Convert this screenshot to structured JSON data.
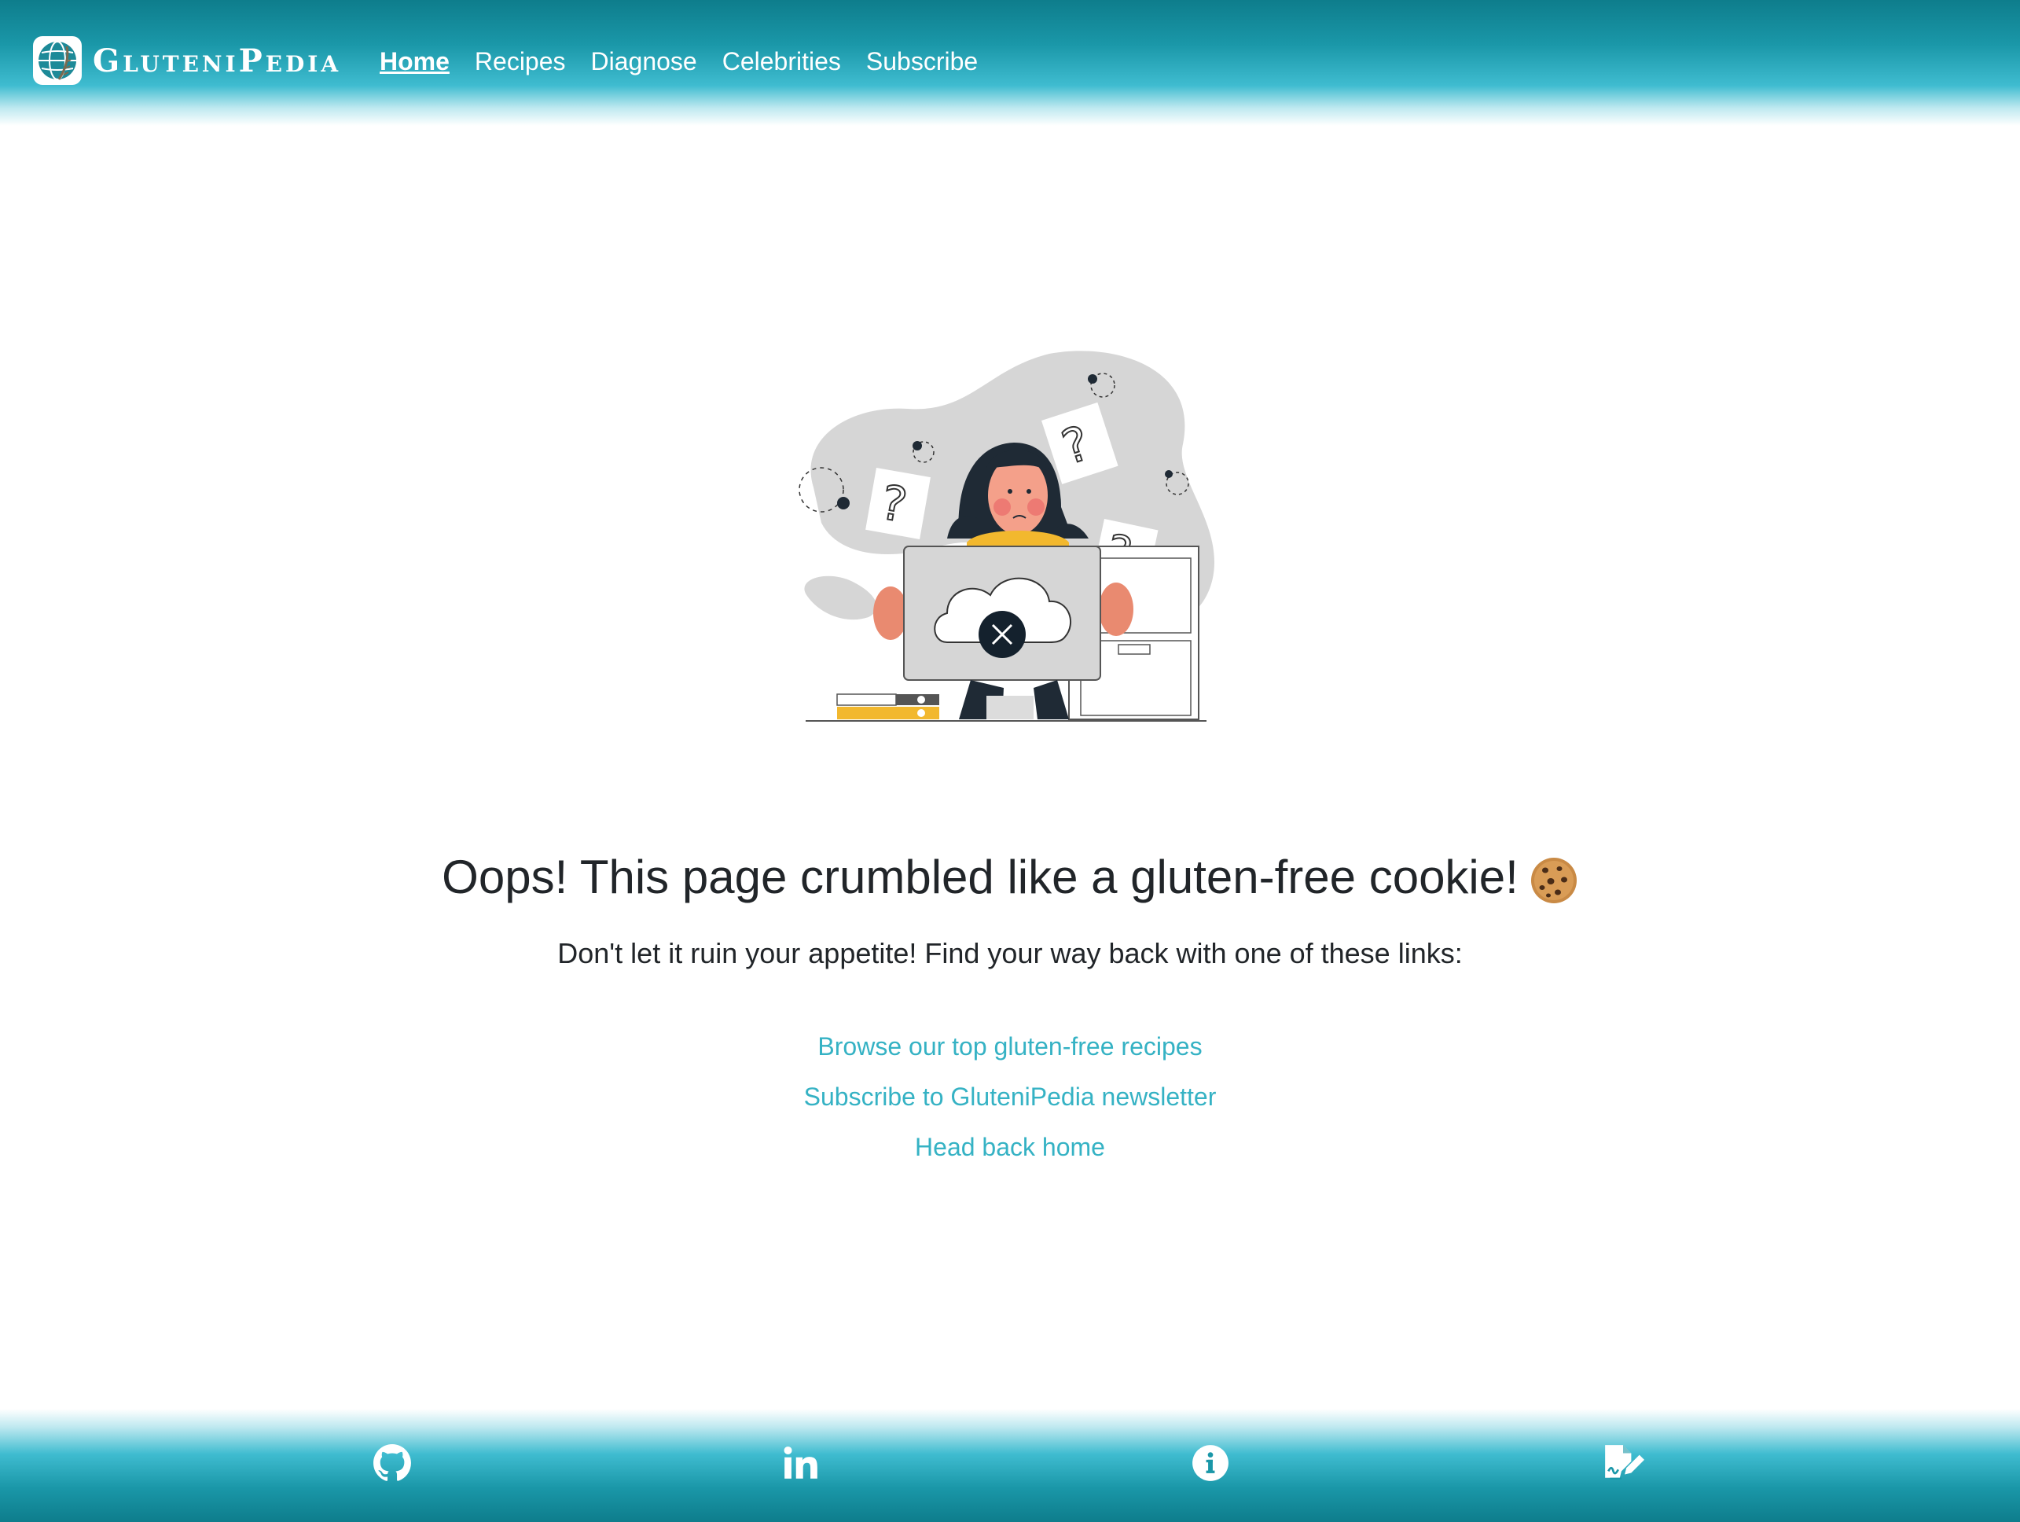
{
  "navbar": {
    "brand": "GluteniPedia",
    "links": [
      {
        "label": "Home",
        "active": true
      },
      {
        "label": "Recipes"
      },
      {
        "label": "Diagnose"
      },
      {
        "label": "Celebrities"
      },
      {
        "label": "Subscribe"
      }
    ]
  },
  "main": {
    "heading": "Oops! This page crumbled like a gluten-free cookie!",
    "heading_emoji": "cookie-icon",
    "subtitle": "Don't let it ruin your appetite! Find your way back with one of these links:",
    "links": [
      {
        "label": "Browse our top gluten-free recipes"
      },
      {
        "label": "Subscribe to GluteniPedia newsletter"
      },
      {
        "label": "Head back home"
      }
    ],
    "illustration": "confused-person-with-laptop-error-illustration"
  },
  "footer": {
    "icons": [
      "github-icon",
      "linkedin-icon",
      "info-icon",
      "signature-document-icon"
    ]
  },
  "colors": {
    "accent": "#35b2c4",
    "header_dark": "#0e7d8c",
    "header_light": "#3fbcd0",
    "text": "#212529"
  }
}
